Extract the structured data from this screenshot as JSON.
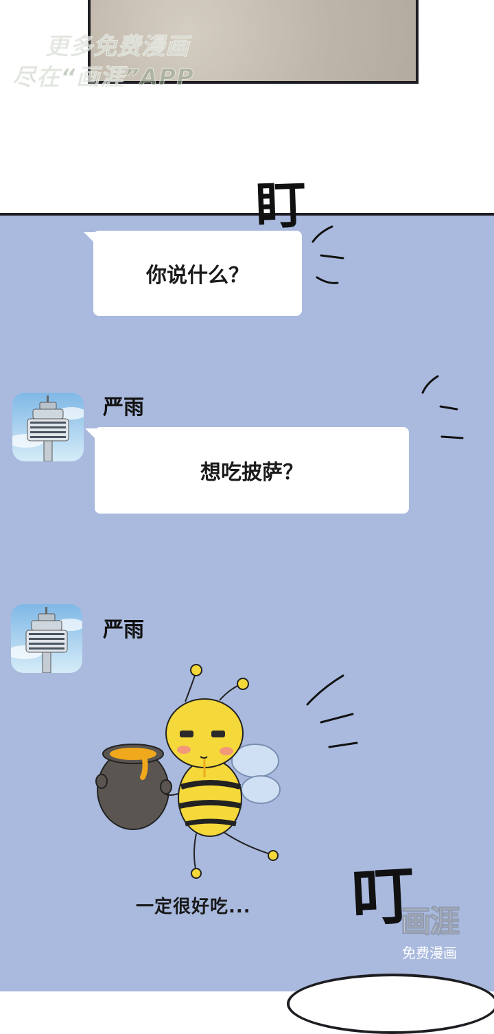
{
  "watermark_top": {
    "line1": "更多免费漫画",
    "line2": "尽在“画涯”APP"
  },
  "sfx": {
    "stare": "盯",
    "ding": "叮"
  },
  "messages": [
    {
      "text": "你说什么？"
    },
    {
      "sender": "严雨",
      "text": "想吃披萨？"
    },
    {
      "sender": "严雨",
      "sticker": "bee-honey-pot"
    }
  ],
  "bottom_caption": "一定很好吃...",
  "watermark_bottom": {
    "logo": "画涯",
    "sub": "免费漫画"
  },
  "colors": {
    "panel_bg": "#a9bade",
    "bubble": "#ffffff",
    "bee": "#f5d83a",
    "pot": "#5a5550",
    "honey": "#f0a81c"
  }
}
